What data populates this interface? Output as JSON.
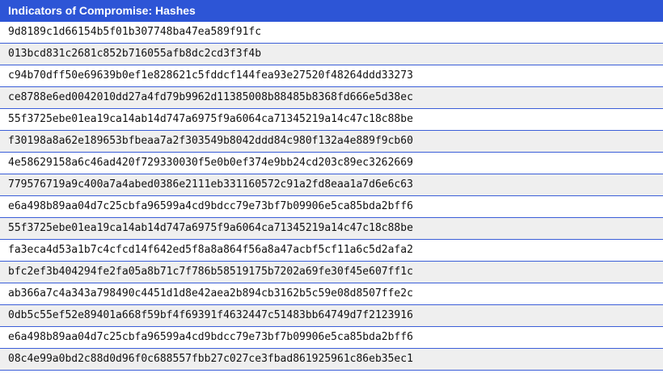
{
  "table": {
    "title": "Indicators of Compromise: Hashes",
    "hashes": [
      "9d8189c1d66154b5f01b307748ba47ea589f91fc",
      "013bcd831c2681c852b716055afb8dc2cd3f3f4b",
      "c94b70dff50e69639b0ef1e828621c5fddcf144fea93e27520f48264ddd33273",
      "ce8788e6ed0042010dd27a4fd79b9962d11385008b88485b8368fd666e5d38ec",
      "55f3725ebe01ea19ca14ab14d747a6975f9a6064ca71345219a14c47c18c88be",
      "f30198a8a62e189653bfbeaa7a2f303549b8042ddd84c980f132a4e889f9cb60",
      "4e58629158a6c46ad420f729330030f5e0b0ef374e9bb24cd203c89ec3262669",
      "779576719a9c400a7a4abed0386e2111eb331160572c91a2fd8eaa1a7d6e6c63",
      "e6a498b89aa04d7c25cbfa96599a4cd9bdcc79e73bf7b09906e5ca85bda2bff6",
      "55f3725ebe01ea19ca14ab14d747a6975f9a6064ca71345219a14c47c18c88be",
      "fa3eca4d53a1b7c4cfcd14f642ed5f8a8a864f56a8a47acbf5cf11a6c5d2afa2",
      "bfc2ef3b404294fe2fa05a8b71c7f786b58519175b7202a69fe30f45e607ff1c",
      "ab366a7c4a343a798490c4451d1d8e42aea2b894cb3162b5c59e08d8507ffe2c",
      "0db5c55ef52e89401a668f59bf4f69391f4632447c51483bb64749d7f2123916",
      "e6a498b89aa04d7c25cbfa96599a4cd9bdcc79e73bf7b09906e5ca85bda2bff6",
      "08c4e99a0bd2c88d0d96f0c688557fbb27c027ce3fbad861925961c86eb35ec1"
    ]
  }
}
